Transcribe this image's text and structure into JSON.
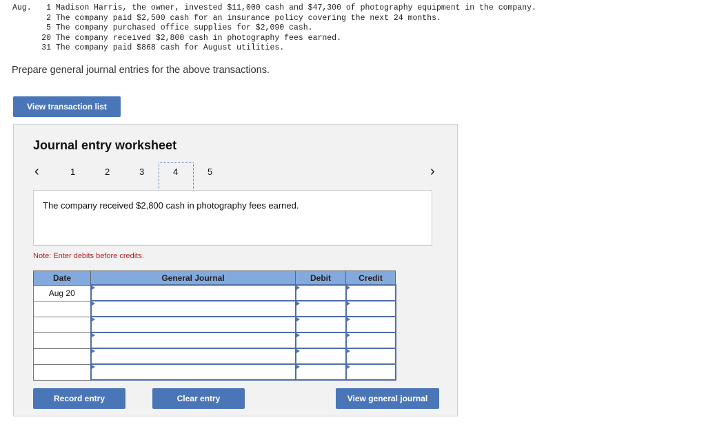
{
  "transactions": {
    "month": "Aug.",
    "items": [
      {
        "day": "1",
        "text": "Madison Harris, the owner, invested $11,000 cash and $47,300 of photography equipment in the company."
      },
      {
        "day": "2",
        "text": "The company paid $2,500 cash for an insurance policy covering the next 24 months."
      },
      {
        "day": "5",
        "text": "The company purchased office supplies for $2,090 cash."
      },
      {
        "day": "20",
        "text": "The company received $2,800 cash in photography fees earned."
      },
      {
        "day": "31",
        "text": "The company paid $868 cash for August utilities."
      }
    ]
  },
  "prompt": "Prepare general journal entries for the above transactions.",
  "view_transaction_list": "View transaction list",
  "worksheet": {
    "title": "Journal entry worksheet",
    "pages": [
      "1",
      "2",
      "3",
      "4",
      "5"
    ],
    "current_page": "4",
    "description": "The company received $2,800 cash in photography fees earned.",
    "note": "Note: Enter debits before credits.",
    "columns": [
      "Date",
      "General Journal",
      "Debit",
      "Credit"
    ],
    "rows": [
      {
        "date": "Aug 20"
      },
      {
        "date": ""
      },
      {
        "date": ""
      },
      {
        "date": ""
      },
      {
        "date": ""
      },
      {
        "date": ""
      }
    ]
  },
  "buttons": {
    "record": "Record entry",
    "clear": "Clear entry",
    "view_journal": "View general journal"
  },
  "colors": {
    "button": "#4a76b8",
    "header": "#84a9dc",
    "note": "#b22222"
  }
}
